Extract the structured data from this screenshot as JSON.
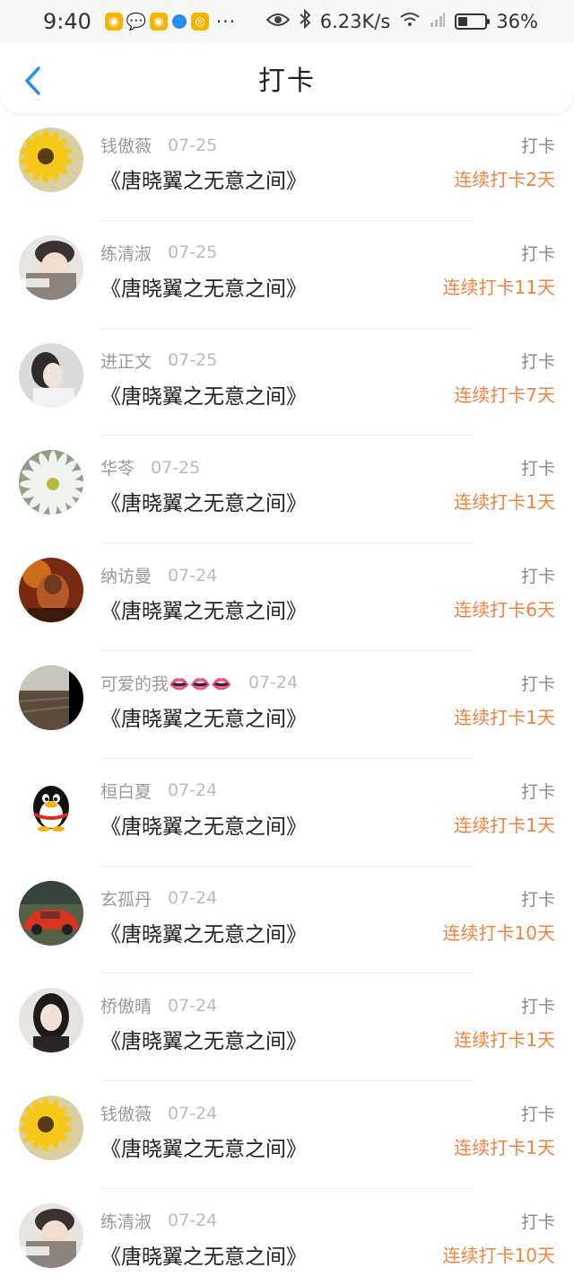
{
  "status_bar": {
    "time": "9:40",
    "dots": "···",
    "speed": "6.23K/s",
    "battery": "36%",
    "battery_level": 0.36
  },
  "header": {
    "title": "打卡"
  },
  "colors": {
    "accent": "#2a8cf0",
    "streak": "#f0823c"
  },
  "rows": [
    {
      "user": "钱傲薇",
      "date": "07-25",
      "title": "《唐晓翼之无意之间》",
      "action": "打卡",
      "streak": "连续打卡2天",
      "avatar": "sunflower-avatar"
    },
    {
      "user": "练清淑",
      "date": "07-25",
      "title": "《唐晓翼之无意之间》",
      "action": "打卡",
      "streak": "连续打卡11天",
      "avatar": "girl-hat-avatar"
    },
    {
      "user": "进正文",
      "date": "07-25",
      "title": "《唐晓翼之无意之间》",
      "action": "打卡",
      "streak": "连续打卡7天",
      "avatar": "girl-profile-avatar"
    },
    {
      "user": "华苓",
      "date": "07-25",
      "title": "《唐晓翼之无意之间》",
      "action": "打卡",
      "streak": "连续打卡1天",
      "avatar": "white-flower-avatar"
    },
    {
      "user": "纳访曼",
      "date": "07-24",
      "title": "《唐晓翼之无意之间》",
      "action": "打卡",
      "streak": "连续打卡6天",
      "avatar": "warrior-avatar"
    },
    {
      "user": "可爱的我👄👄👄",
      "date": "07-24",
      "title": "《唐晓翼之无意之间》",
      "action": "打卡",
      "streak": "连续打卡1天",
      "avatar": "field-avatar"
    },
    {
      "user": "桓白夏",
      "date": "07-24",
      "title": "《唐晓翼之无意之间》",
      "action": "打卡",
      "streak": "连续打卡1天",
      "avatar": "penguin-avatar"
    },
    {
      "user": "玄孤丹",
      "date": "07-24",
      "title": "《唐晓翼之无意之间》",
      "action": "打卡",
      "streak": "连续打卡10天",
      "avatar": "red-car-avatar"
    },
    {
      "user": "桥傲晴",
      "date": "07-24",
      "title": "《唐晓翼之无意之间》",
      "action": "打卡",
      "streak": "连续打卡1天",
      "avatar": "girl-portrait-avatar"
    },
    {
      "user": "钱傲薇",
      "date": "07-24",
      "title": "《唐晓翼之无意之间》",
      "action": "打卡",
      "streak": "连续打卡1天",
      "avatar": "sunflower-avatar"
    },
    {
      "user": "练清淑",
      "date": "07-24",
      "title": "《唐晓翼之无意之间》",
      "action": "打卡",
      "streak": "连续打卡10天",
      "avatar": "girl-hat-avatar"
    }
  ]
}
